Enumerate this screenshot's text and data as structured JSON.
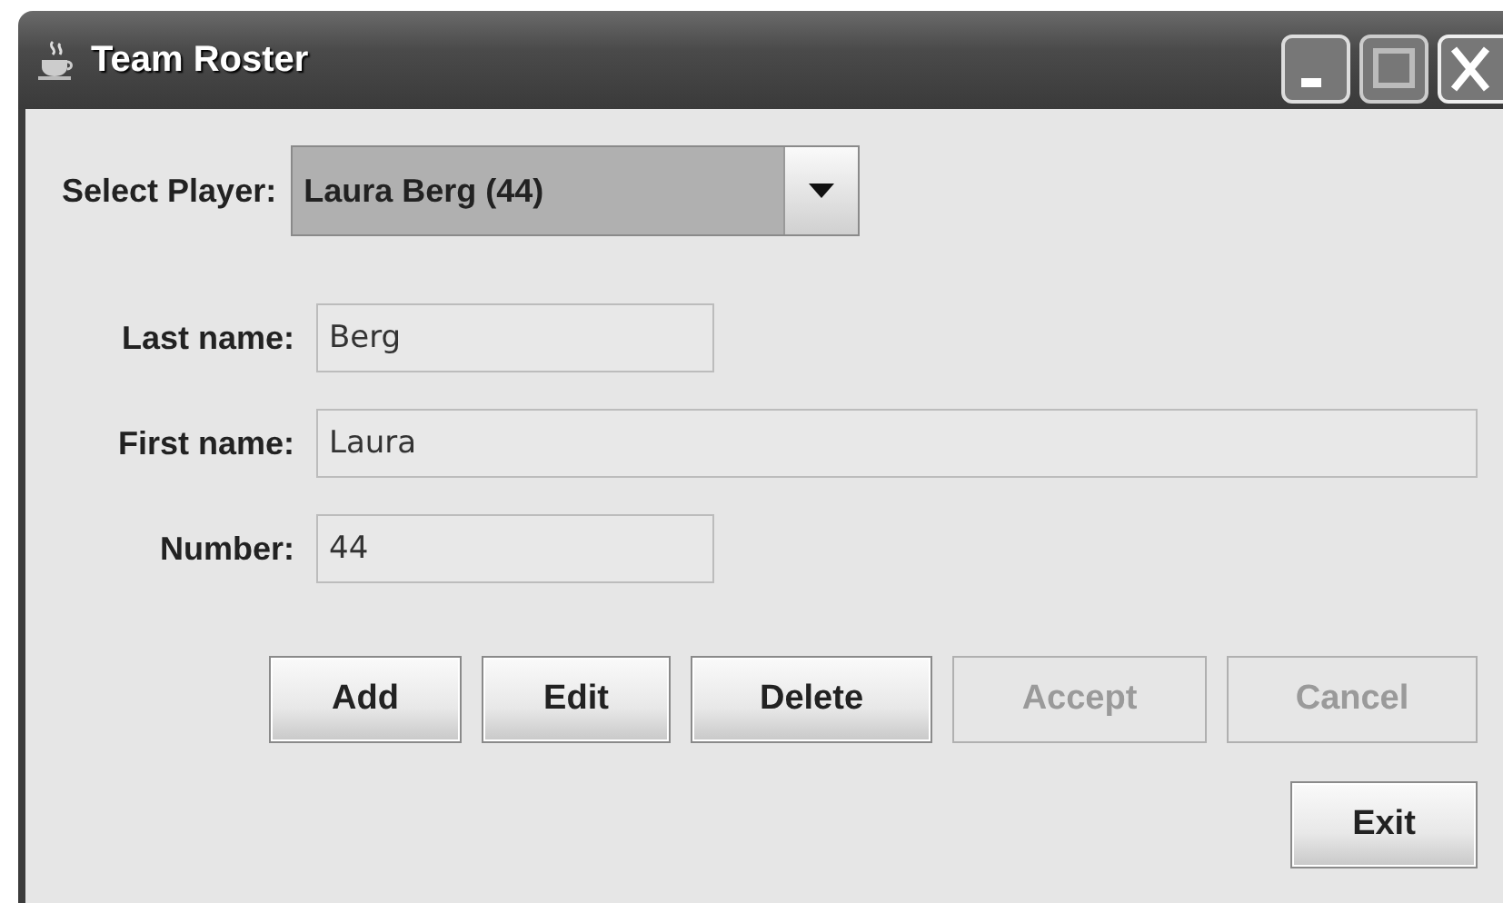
{
  "window": {
    "title": "Team Roster"
  },
  "player_select": {
    "label": "Select Player:",
    "value": "Laura Berg (44)"
  },
  "fields": [
    {
      "label": "Last name:",
      "value": "Berg"
    },
    {
      "label": "First name:",
      "value": "Laura"
    },
    {
      "label": "Number:",
      "value": "44"
    }
  ],
  "buttons": [
    {
      "label": "Add",
      "disabled": false
    },
    {
      "label": "Edit",
      "disabled": false
    },
    {
      "label": "Delete",
      "disabled": false
    },
    {
      "label": "Accept",
      "disabled": true
    },
    {
      "label": "Cancel",
      "disabled": true
    }
  ],
  "exit_button": {
    "label": "Exit",
    "disabled": false
  }
}
